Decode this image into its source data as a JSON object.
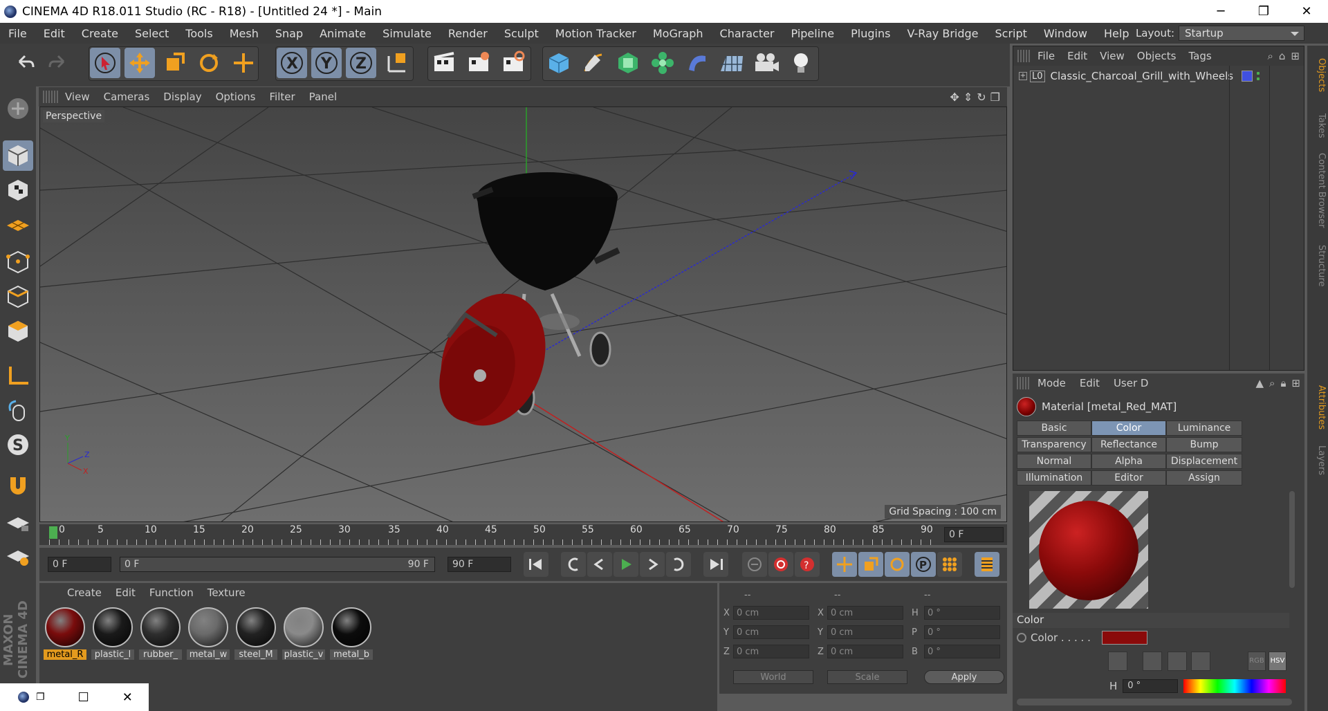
{
  "window": {
    "title": "CINEMA 4D R18.011 Studio (RC - R18) - [Untitled 24 *] - Main",
    "minimize": "─",
    "maximize": "❐",
    "close": "✕"
  },
  "menu": {
    "items": [
      "File",
      "Edit",
      "Create",
      "Select",
      "Tools",
      "Mesh",
      "Snap",
      "Animate",
      "Simulate",
      "Render",
      "Sculpt",
      "Motion Tracker",
      "MoGraph",
      "Character",
      "Pipeline",
      "Plugins",
      "V-Ray Bridge",
      "Script",
      "Window",
      "Help"
    ],
    "layout_label": "Layout:",
    "layout_value": "Startup"
  },
  "viewport": {
    "menu": [
      "View",
      "Cameras",
      "Display",
      "Options",
      "Filter",
      "Panel"
    ],
    "camera_label": "Perspective",
    "grid_spacing": "Grid Spacing : 100 cm"
  },
  "timeline": {
    "ticks": [
      "0",
      "5",
      "10",
      "15",
      "20",
      "25",
      "30",
      "35",
      "40",
      "45",
      "50",
      "55",
      "60",
      "65",
      "70",
      "75",
      "80",
      "85",
      "90"
    ],
    "current_frame": "0 F"
  },
  "transport": {
    "start": "0 F",
    "range_start": "0 F",
    "range_end": "90 F",
    "end": "90 F"
  },
  "material_manager": {
    "menu": [
      "Create",
      "Edit",
      "Function",
      "Texture"
    ],
    "materials": [
      {
        "label": "metal_R",
        "color": "#7a0c0c",
        "selected": true
      },
      {
        "label": "plastic_l",
        "color": "#1a1a1a",
        "selected": false
      },
      {
        "label": "rubber_",
        "color": "#2e2e2e",
        "selected": false
      },
      {
        "label": "metal_w",
        "color": "#6a6a6a",
        "selected": false
      },
      {
        "label": "steel_M",
        "color": "#222222",
        "selected": false
      },
      {
        "label": "plastic_v",
        "color": "#8a8a8a",
        "selected": false
      },
      {
        "label": "metal_b",
        "color": "#0c0c0c",
        "selected": false
      }
    ]
  },
  "coordinates": {
    "headers": [
      "--",
      "--",
      "--"
    ],
    "rows": [
      {
        "a": "X",
        "av": "0 cm",
        "b": "X",
        "bv": "0 cm",
        "c": "H",
        "cv": "0 °"
      },
      {
        "a": "Y",
        "av": "0 cm",
        "b": "Y",
        "bv": "0 cm",
        "c": "P",
        "cv": "0 °"
      },
      {
        "a": "Z",
        "av": "0 cm",
        "b": "Z",
        "bv": "0 cm",
        "c": "B",
        "cv": "0 °"
      }
    ],
    "world": "World",
    "scale": "Scale",
    "apply": "Apply"
  },
  "object_manager": {
    "menu": [
      "File",
      "Edit",
      "View",
      "Objects",
      "Tags"
    ],
    "object_name": "Classic_Charcoal_Grill_with_Wheels",
    "layer": "L0"
  },
  "attribute_manager": {
    "menu": [
      "Mode",
      "Edit",
      "User D"
    ],
    "material_title": "Material [metal_Red_MAT]",
    "tabs": [
      [
        "Basic",
        "Color",
        "Luminance"
      ],
      [
        "Transparency",
        "Reflectance",
        "Bump"
      ],
      [
        "Normal",
        "Alpha",
        "Displacement"
      ],
      [
        "Illumination",
        "Editor",
        "Assign"
      ]
    ],
    "active_tab": "Color",
    "section": "Color",
    "color_label": "Color . . . . .",
    "color_value": "#8a0a0a",
    "h_label": "H",
    "h_value": "0 °",
    "rgb": "RGB",
    "hsv": "HSV"
  },
  "side_tabs": [
    "Objects",
    "Takes",
    "Content Browser",
    "Structure",
    "Attributes",
    "Layers"
  ],
  "logo": "MAXON CINEMA 4D"
}
